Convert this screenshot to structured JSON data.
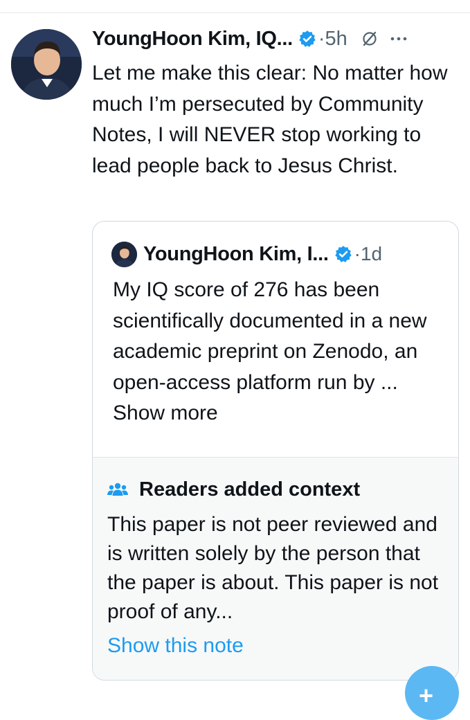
{
  "tweet": {
    "author_name": "YoungHoon Kim, IQ...",
    "time": "·5h",
    "text": "Let me make this clear: No matter how much I’m persecuted by Community Notes, I will NEVER stop working to lead people back to Jesus Christ."
  },
  "quote": {
    "author_name": "YoungHoon Kim, I...",
    "time": "·1d",
    "text_main": "My IQ score of 276 has been scientifically documented in a new academic preprint on Zenodo, an open-access platform run by ...",
    "show_more": " Show more"
  },
  "context": {
    "title": "Readers added context",
    "text": "This paper is not peer reviewed and is written solely by the person that the paper is about. This paper is not proof of any...",
    "link": "Show this note"
  },
  "fab": {
    "label": "+"
  },
  "icons": {
    "verified": "verified-badge-icon",
    "grok": "grok-icon",
    "more": "more-options-icon",
    "people": "people-icon"
  },
  "colors": {
    "accent": "#1d9bf0",
    "text": "#0f1419",
    "secondary": "#536471",
    "note_bg": "#f7f9f9"
  }
}
